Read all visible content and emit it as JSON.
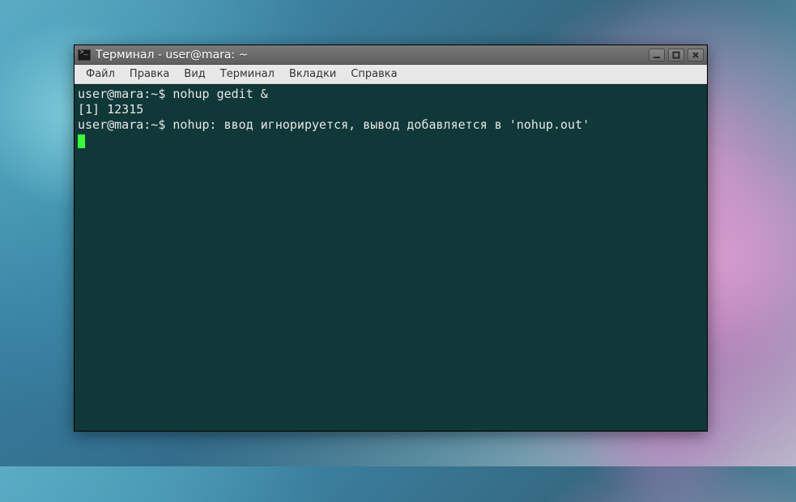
{
  "window": {
    "title": "Терминал - user@mara: ~"
  },
  "menu": {
    "file": "Файл",
    "edit": "Правка",
    "view": "Вид",
    "terminal": "Терминал",
    "tabs": "Вкладки",
    "help": "Справка"
  },
  "terminal": {
    "lines": [
      "user@mara:~$ nohup gedit &",
      "[1] 12315",
      "user@mara:~$ nohup: ввод игнорируется, вывод добавляется в 'nohup.out'"
    ]
  },
  "colors": {
    "terminal_bg": "#103838",
    "terminal_fg": "#e6e6e6",
    "cursor": "#3cff3c"
  }
}
